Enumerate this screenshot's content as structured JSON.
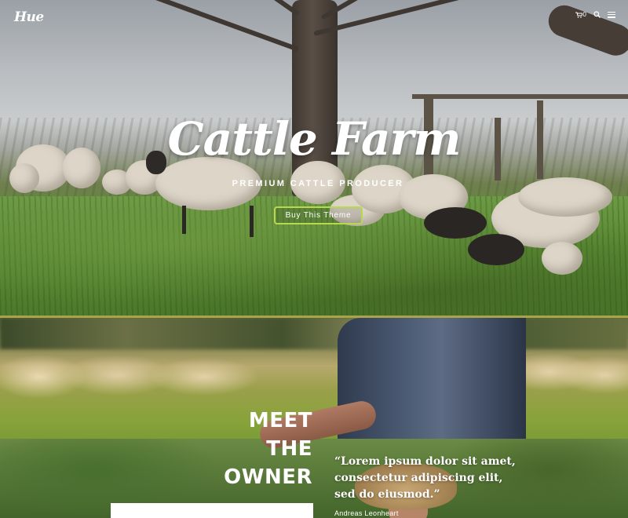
{
  "header": {
    "logo_text": "Hue",
    "cart_count": "0",
    "icons": [
      "cart-icon",
      "search-icon",
      "menu-icon"
    ]
  },
  "hero": {
    "title": "Cattle Farm",
    "subtitle": "PREMIUM CATTLE PRODUCER",
    "cta_label": "Buy This Theme",
    "cta_border_color": "#b7d84f"
  },
  "owner": {
    "heading_lines": [
      "MEET",
      "THE",
      "OWNER"
    ],
    "quote": "“Lorem ipsum dolor sit amet, consectetur adipiscing elit, sed do eiusmod.”",
    "author": "Andreas Leonheart"
  },
  "colors": {
    "divider": "#a9a44b",
    "text": "#ffffff"
  }
}
